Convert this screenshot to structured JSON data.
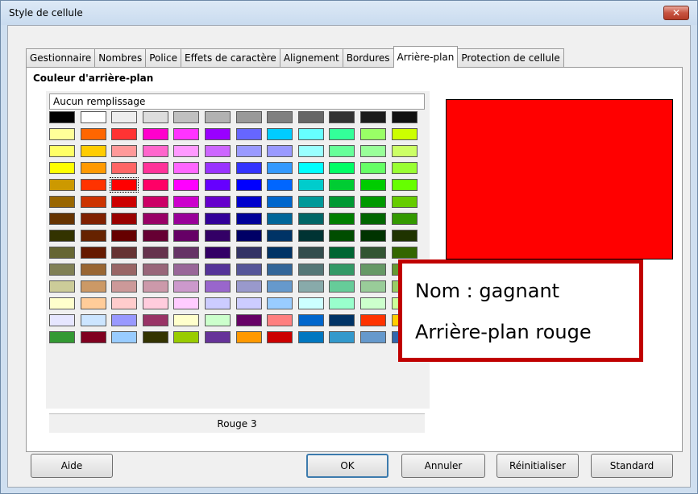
{
  "window": {
    "title": "Style de cellule",
    "close_glyph": "✕"
  },
  "tabs": [
    {
      "label": "Gestionnaire"
    },
    {
      "label": "Nombres"
    },
    {
      "label": "Police"
    },
    {
      "label": "Effets de caractère"
    },
    {
      "label": "Alignement"
    },
    {
      "label": "Bordures"
    },
    {
      "label": "Arrière-plan",
      "active": true
    },
    {
      "label": "Protection de cellule"
    }
  ],
  "panel": {
    "section_title": "Couleur d'arrière-plan",
    "palette_name": "Aucun remplissage",
    "selected_color_name": "Rouge 3",
    "preview_color": "#ff0000"
  },
  "palette": {
    "columns": 12,
    "selected_index": 50,
    "colors": [
      "#000000",
      "#ffffff",
      "#eeeeee",
      "#dddddd",
      "#c0c0c0",
      "#b2b2b2",
      "#999999",
      "#808080",
      "#666666",
      "#333333",
      "#1c1c1c",
      "#111111",
      "#ffff99",
      "#ff6600",
      "#ff3333",
      "#ff00cc",
      "#ff33ff",
      "#9900ff",
      "#6666ff",
      "#00ccff",
      "#66ffff",
      "#33ff99",
      "#99ff66",
      "#ccff00",
      "#ffff66",
      "#ffcc00",
      "#ff9999",
      "#ff66cc",
      "#ff99ff",
      "#cc66ff",
      "#9999ff",
      "#9999ff",
      "#99ffff",
      "#66ff99",
      "#99ff99",
      "#ccff66",
      "#ffff00",
      "#ff9900",
      "#ff6666",
      "#ff3399",
      "#ff66ff",
      "#9933ff",
      "#3333ff",
      "#3399ff",
      "#00ffff",
      "#00ff66",
      "#66ff66",
      "#99ff33",
      "#cc9900",
      "#ff3300",
      "#ff0000",
      "#ff0066",
      "#ff00ff",
      "#6600ff",
      "#0000ff",
      "#0066ff",
      "#00cccc",
      "#00cc33",
      "#00cc00",
      "#66ff00",
      "#996600",
      "#cc3300",
      "#cc0000",
      "#cc0066",
      "#cc00cc",
      "#6600cc",
      "#0000cc",
      "#0066cc",
      "#009999",
      "#009933",
      "#009900",
      "#66cc00",
      "#663300",
      "#802000",
      "#990000",
      "#990066",
      "#990099",
      "#330099",
      "#000099",
      "#006699",
      "#006666",
      "#007f00",
      "#006600",
      "#339900",
      "#333300",
      "#662200",
      "#660000",
      "#660033",
      "#660066",
      "#330066",
      "#000066",
      "#003366",
      "#003333",
      "#004d00",
      "#003300",
      "#1f3300",
      "#666633",
      "#661a00",
      "#663333",
      "#66334d",
      "#663366",
      "#330066",
      "#333366",
      "#003366",
      "#334d4d",
      "#006633",
      "#335533",
      "#336600",
      "#808055",
      "#996633",
      "#996666",
      "#99667a",
      "#996699",
      "#553399",
      "#555599",
      "#336699",
      "#557777",
      "#339966",
      "#669966",
      "#669933",
      "#cccc99",
      "#cc9966",
      "#cc9999",
      "#cc99aa",
      "#cc99cc",
      "#9966cc",
      "#9999cc",
      "#6699cc",
      "#88aaaa",
      "#66cc99",
      "#99cc99",
      "#99cc66",
      "#ffffcc",
      "#ffcc99",
      "#ffcccc",
      "#ffccdd",
      "#ffccff",
      "#ccccff",
      "#ccccff",
      "#99ccff",
      "#ccffff",
      "#99ffcc",
      "#ccffcc",
      "#ccff99",
      "#e6e6ff",
      "#cce5ff",
      "#9999ff",
      "#993366",
      "#ffffcc",
      "#ccffcc",
      "#660066",
      "#ff8080",
      "#0066cc",
      "#003366",
      "#ff3300",
      "#ffcc00",
      "#339933",
      "#800020",
      "#99ccff",
      "#333300",
      "#99cc00",
      "#663399",
      "#ff9900",
      "#cc0000",
      "#0077c0",
      "#3399cc",
      "#6699cc",
      "#3366aa"
    ]
  },
  "annotation": {
    "line1": "Nom : gagnant",
    "line2": "Arrière-plan rouge",
    "border_color": "#c00000"
  },
  "buttons": {
    "help": "Aide",
    "ok": "OK",
    "cancel": "Annuler",
    "reset": "Réinitialiser",
    "standard": "Standard"
  }
}
